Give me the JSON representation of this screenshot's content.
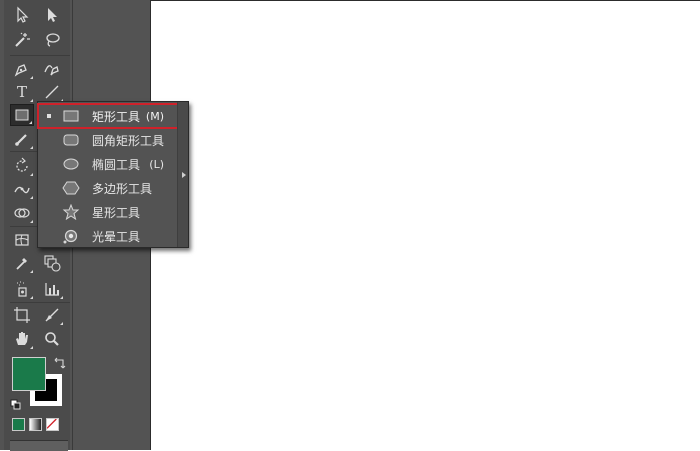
{
  "colors": {
    "panel": "#535353",
    "fill": "#1a7a4a",
    "stroke": "#000000",
    "highlight": "#d0212a"
  },
  "tools": [
    {
      "name": "selection-tool",
      "icon": "arrow-icon"
    },
    {
      "name": "direct-selection-tool",
      "icon": "hollow-arrow-icon"
    },
    {
      "name": "magic-wand-tool",
      "icon": "magic-wand-icon"
    },
    {
      "name": "lasso-tool",
      "icon": "lasso-icon"
    },
    {
      "name": "pen-tool",
      "icon": "pen-icon"
    },
    {
      "name": "curvature-tool",
      "icon": "curvature-icon"
    },
    {
      "name": "type-tool",
      "icon": "type-icon",
      "glyph": "T"
    },
    {
      "name": "line-tool",
      "icon": "line-icon"
    },
    {
      "name": "rectangle-tool",
      "icon": "rectangle-icon"
    },
    {
      "name": "paintbrush-tool",
      "icon": "brush-icon"
    },
    {
      "name": "rotate-tool",
      "icon": "rotate-icon"
    },
    {
      "name": "width-tool",
      "icon": "width-icon"
    },
    {
      "name": "shape-builder-tool",
      "icon": "shape-builder-icon"
    },
    {
      "name": "mesh-tool",
      "icon": "mesh-icon"
    },
    {
      "name": "eyedropper-tool",
      "icon": "eyedropper-icon"
    },
    {
      "name": "blend-tool",
      "icon": "blend-icon"
    },
    {
      "name": "symbol-sprayer-tool",
      "icon": "sprayer-icon"
    },
    {
      "name": "graph-tool",
      "icon": "bar-graph-icon"
    },
    {
      "name": "artboard-tool",
      "icon": "artboard-icon"
    },
    {
      "name": "slice-tool",
      "icon": "slice-icon"
    },
    {
      "name": "hand-tool",
      "icon": "hand-icon"
    },
    {
      "name": "zoom-tool",
      "icon": "zoom-icon"
    }
  ],
  "flyout": {
    "items": [
      {
        "label": "矩形工具",
        "shortcut": "(M)",
        "icon": "rectangle-icon",
        "selected": true
      },
      {
        "label": "圆角矩形工具",
        "shortcut": "",
        "icon": "rounded-rectangle-icon",
        "selected": false
      },
      {
        "label": "椭圆工具",
        "shortcut": "(L)",
        "icon": "ellipse-icon",
        "selected": false
      },
      {
        "label": "多边形工具",
        "shortcut": "",
        "icon": "polygon-icon",
        "selected": false
      },
      {
        "label": "星形工具",
        "shortcut": "",
        "icon": "star-icon",
        "selected": false
      },
      {
        "label": "光晕工具",
        "shortcut": "",
        "icon": "flare-icon",
        "selected": false
      }
    ]
  }
}
